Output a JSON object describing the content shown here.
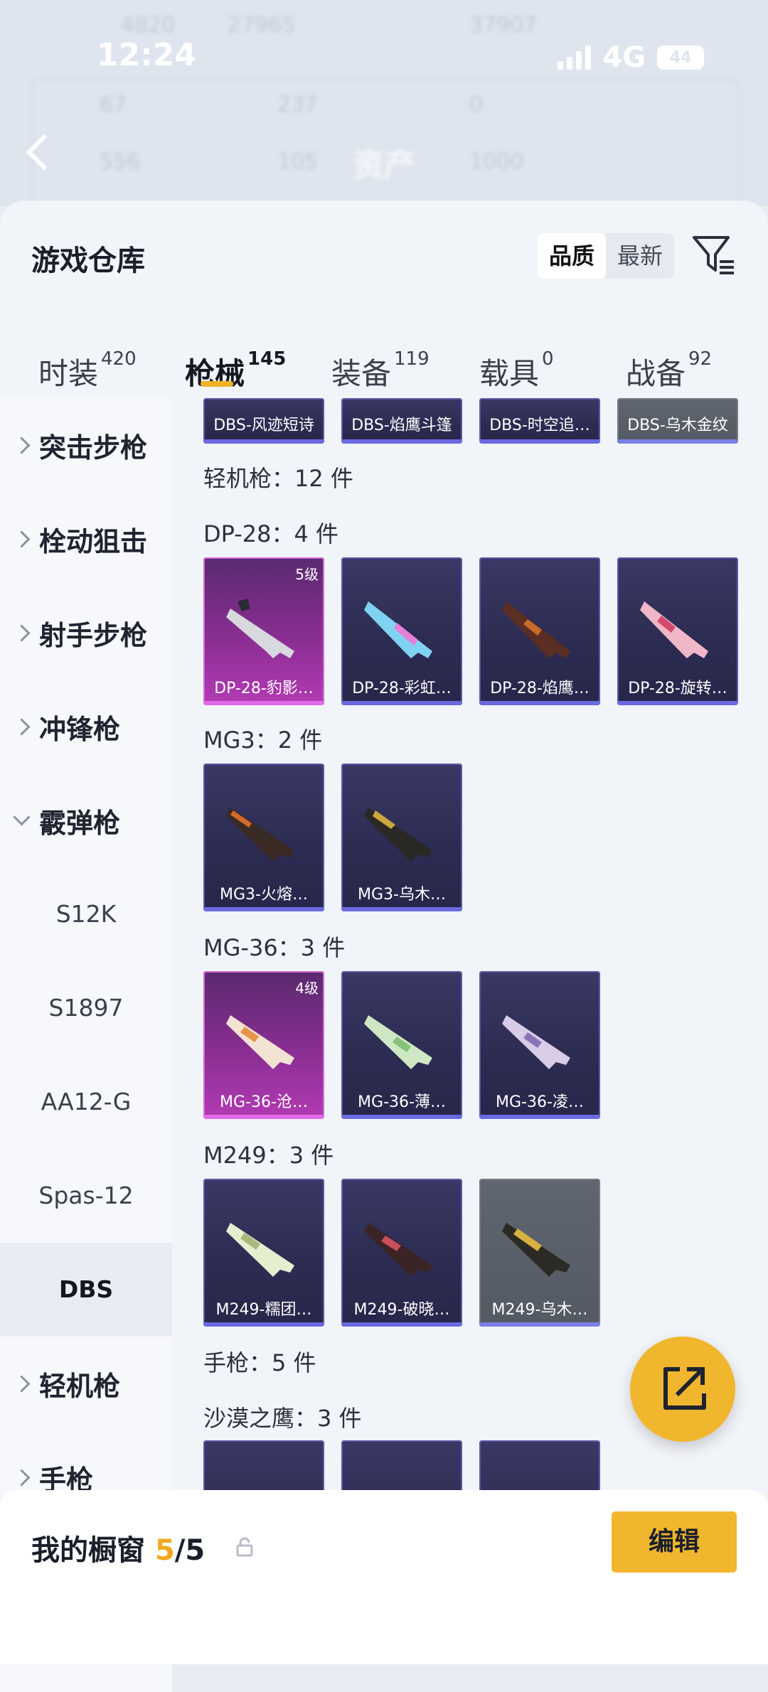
{
  "status_bar": {
    "time": "12:24",
    "network": "4G",
    "battery": "44"
  },
  "background_header": {
    "title": "资产",
    "stats": [
      "4820",
      "27965",
      "37907",
      "67",
      "237",
      "0",
      "556",
      "105",
      "1000"
    ]
  },
  "sheet": {
    "title": "游戏仓库",
    "sort_options": [
      "品质",
      "最新"
    ],
    "active_sort": "品质",
    "tabs": [
      {
        "label": "时装",
        "count": "420"
      },
      {
        "label": "枪械",
        "count": "145"
      },
      {
        "label": "装备",
        "count": "119"
      },
      {
        "label": "载具",
        "count": "0"
      },
      {
        "label": "战备",
        "count": "92"
      }
    ],
    "active_tab": "枪械"
  },
  "sidebar": {
    "items": [
      {
        "label": "突击步枪",
        "expanded": false
      },
      {
        "label": "栓动狙击",
        "expanded": false
      },
      {
        "label": "射手步枪",
        "expanded": false
      },
      {
        "label": "冲锋枪",
        "expanded": false
      },
      {
        "label": "霰弹枪",
        "expanded": true
      }
    ],
    "sub_items": [
      "S12K",
      "S1897",
      "AA12-G",
      "Spas-12",
      "DBS"
    ],
    "active_sub": "DBS",
    "items_after": [
      {
        "label": "轻机枪"
      },
      {
        "label": "手枪"
      }
    ]
  },
  "content": {
    "top_partial_cards": [
      "DBS-风迹短诗",
      "DBS-焰鹰斗篷",
      "DBS-时空追…",
      "DBS-乌木金纹"
    ],
    "section_lmg": "轻机枪：12 件",
    "groups": [
      {
        "label": "DP-28：4 件",
        "cards": [
          {
            "name": "DP-28-豹影…",
            "level": "5级",
            "style": "pink"
          },
          {
            "name": "DP-28-彩虹…",
            "style": "blue"
          },
          {
            "name": "DP-28-焰鹰…",
            "style": "blue"
          },
          {
            "name": "DP-28-旋转…",
            "style": "blue"
          }
        ]
      },
      {
        "label": "MG3：2 件",
        "cards": [
          {
            "name": "MG3-火熔…",
            "style": "blue"
          },
          {
            "name": "MG3-乌木…",
            "style": "blue"
          }
        ]
      },
      {
        "label": "MG-36：3 件",
        "cards": [
          {
            "name": "MG-36-沧…",
            "level": "4级",
            "style": "pink"
          },
          {
            "name": "MG-36-薄…",
            "style": "blue"
          },
          {
            "name": "MG-36-凌…",
            "style": "blue"
          }
        ]
      },
      {
        "label": "M249：3 件",
        "cards": [
          {
            "name": "M249-糯团…",
            "style": "blue"
          },
          {
            "name": "M249-破晓…",
            "style": "blue"
          },
          {
            "name": "M249-乌木…",
            "style": "gray"
          }
        ]
      }
    ],
    "section_pistol": "手枪：5 件",
    "group_deagle": "沙漠之鹰：3 件"
  },
  "bottom_bar": {
    "title": "我的橱窗",
    "count_current": "5",
    "count_total": "/5",
    "edit_label": "编辑"
  },
  "colors": {
    "accent": "#f0b62d",
    "tab_underline": "#f0b028",
    "epic": "#b33bb3",
    "rare": "#2d2c52"
  }
}
